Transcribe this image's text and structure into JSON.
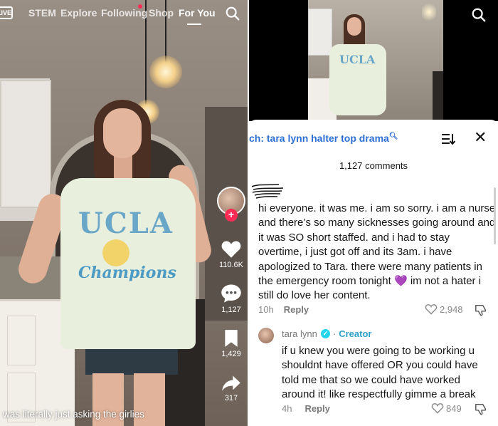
{
  "left": {
    "nav": {
      "live_label": "LIVE",
      "tabs": [
        "STEM",
        "Explore",
        "Following",
        "Shop",
        "For You"
      ],
      "active_tab": "For You"
    },
    "actions": {
      "likes": "110.6K",
      "comments": "1,127",
      "saves": "1,429",
      "shares": "317"
    },
    "caption": "was literally just asking the girlies"
  },
  "right": {
    "search_query": "ch: tara lynn halter top drama",
    "comment_count": "1,127 comments",
    "comments": [
      {
        "text": "hi everyone. it was me. i am so sorry. i am a nurse and there’s so many sicknesses going around and it was SO short staffed. and i had to stay overtime, i just got off and its 3am. i have apologized to Tara. there were many patients in the emergency room tonight",
        "emoji": "💜",
        "text_end": "im not a hater i still do love her content.",
        "time": "10h",
        "reply_label": "Reply",
        "likes": "2,948"
      },
      {
        "author": "tara lynn",
        "badge": "Creator",
        "separator": "·",
        "text": "if u knew you were going to be working u shouldnt have offered OR you could have told me that so we could have worked around it! like respectfully gimme a break",
        "time": "4h",
        "reply_label": "Reply",
        "likes": "849"
      }
    ]
  },
  "colors": {
    "link_blue": "#2e6fd6",
    "creator_teal": "#2ea0c8",
    "follow_red": "#fe2c55",
    "verified_cyan": "#20d5ec"
  }
}
